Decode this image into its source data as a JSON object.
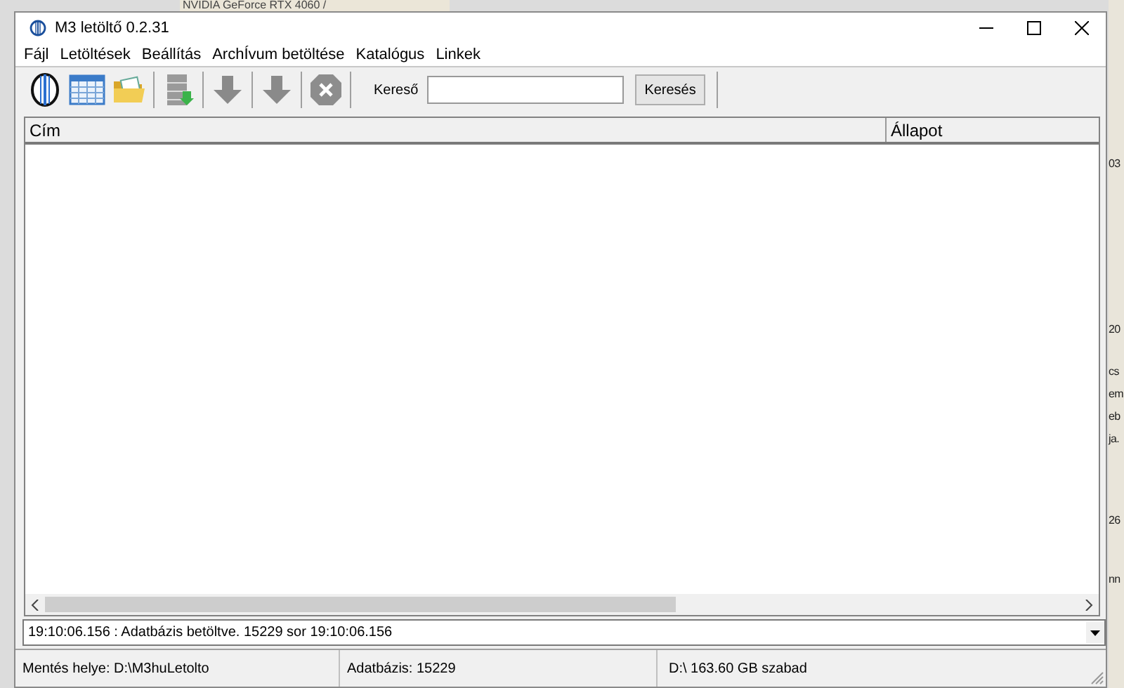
{
  "background": {
    "top_text": "NVIDIA GeForce RTX 4060 /",
    "edge_fragments": [
      "03",
      "20",
      "cs",
      "em",
      "eb",
      "ja.",
      "26",
      "nn"
    ]
  },
  "window": {
    "title": "M3 letöltő 0.2.31"
  },
  "menu": [
    "Fájl",
    "Letöltések",
    "Beállítás",
    "ArchÍvum betöltése",
    "Katalógus",
    "Linkek"
  ],
  "toolbar": {
    "search_label": "Kereső",
    "search_button": "Keresés"
  },
  "table": {
    "columns": [
      "Cím",
      "Állapot"
    ]
  },
  "log": {
    "value": "19:10:06.156 : Adatbázis betöltve. 15229 sor 19:10:06.156"
  },
  "status_bar": [
    "Mentés helye: D:\\M3huLetolto",
    "Adatbázis: 15229",
    "D:\\  163.60 GB szabad"
  ]
}
